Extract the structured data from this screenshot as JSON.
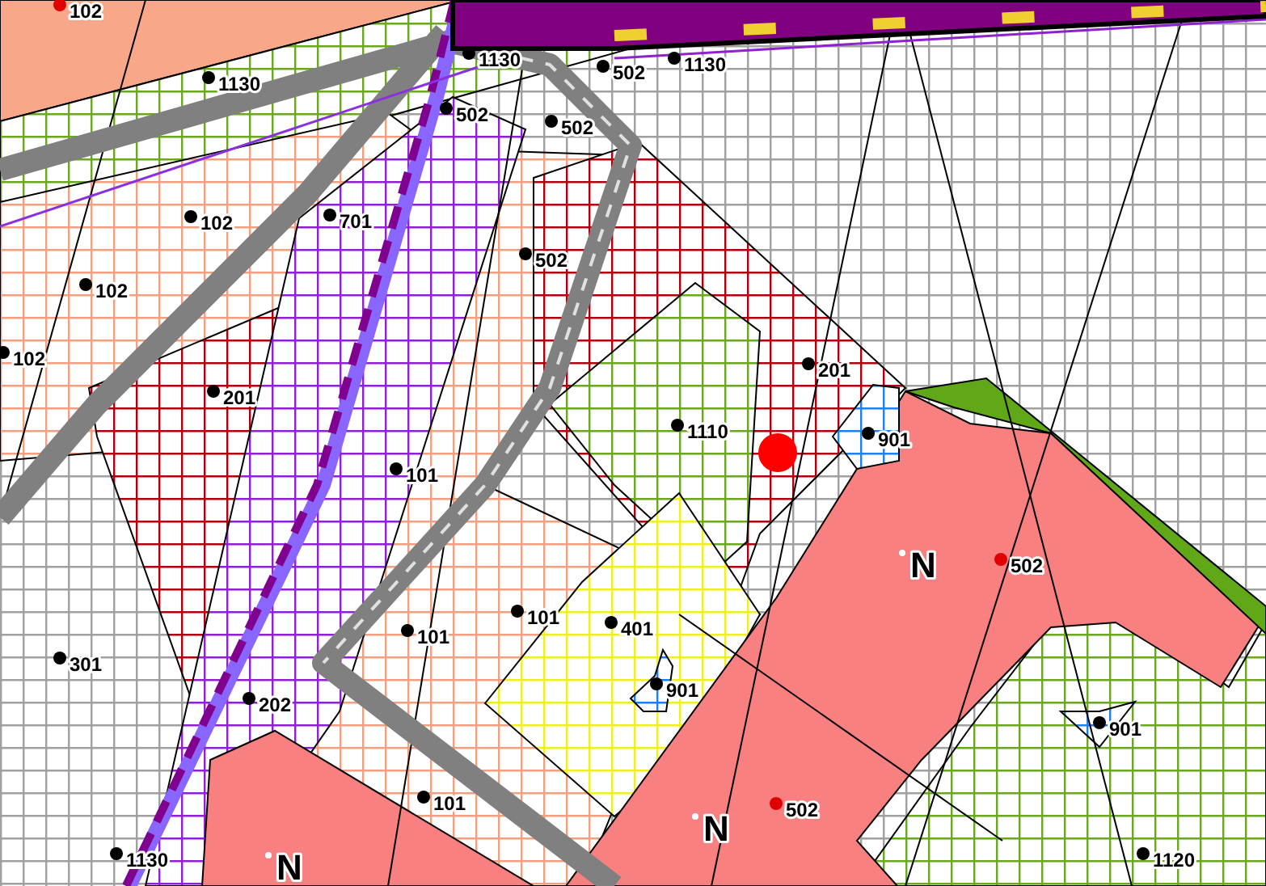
{
  "map": {
    "labels": [
      {
        "kind": "point",
        "text": "102",
        "color": "#e00000"
      },
      {
        "kind": "point",
        "text": "1130",
        "color": "#000000"
      },
      {
        "kind": "point",
        "text": "1130",
        "color": "#000000"
      },
      {
        "kind": "point",
        "text": "502",
        "color": "#000000"
      },
      {
        "kind": "point",
        "text": "1130",
        "color": "#000000"
      },
      {
        "kind": "point",
        "text": "502",
        "color": "#000000"
      },
      {
        "kind": "point",
        "text": "502",
        "color": "#000000"
      },
      {
        "kind": "point",
        "text": "102",
        "color": "#000000"
      },
      {
        "kind": "point",
        "text": "701",
        "color": "#000000"
      },
      {
        "kind": "point",
        "text": "102",
        "color": "#000000"
      },
      {
        "kind": "point",
        "text": "502",
        "color": "#000000"
      },
      {
        "kind": "point",
        "text": "102",
        "color": "#000000"
      },
      {
        "kind": "point",
        "text": "201",
        "color": "#000000"
      },
      {
        "kind": "point",
        "text": "201",
        "color": "#000000"
      },
      {
        "kind": "point",
        "text": "1110",
        "color": "#000000"
      },
      {
        "kind": "point",
        "text": "901",
        "color": "#000000"
      },
      {
        "kind": "point",
        "text": "101",
        "color": "#000000"
      },
      {
        "kind": "zone",
        "text": "N",
        "color": "#ffffff"
      },
      {
        "kind": "point",
        "text": "502",
        "color": "#e00000"
      },
      {
        "kind": "point",
        "text": "101",
        "color": "#000000"
      },
      {
        "kind": "point",
        "text": "401",
        "color": "#000000"
      },
      {
        "kind": "point",
        "text": "101",
        "color": "#000000"
      },
      {
        "kind": "point",
        "text": "301",
        "color": "#000000"
      },
      {
        "kind": "point",
        "text": "901",
        "color": "#000000"
      },
      {
        "kind": "point",
        "text": "202",
        "color": "#000000"
      },
      {
        "kind": "point",
        "text": "901",
        "color": "#000000"
      },
      {
        "kind": "point",
        "text": "101",
        "color": "#000000"
      },
      {
        "kind": "zone",
        "text": "N",
        "color": "#ffffff"
      },
      {
        "kind": "point",
        "text": "502",
        "color": "#e00000"
      },
      {
        "kind": "point",
        "text": "1130",
        "color": "#000000"
      },
      {
        "kind": "zone",
        "text": "N",
        "color": "#ffffff"
      },
      {
        "kind": "point",
        "text": "1120",
        "color": "#000000"
      }
    ]
  }
}
